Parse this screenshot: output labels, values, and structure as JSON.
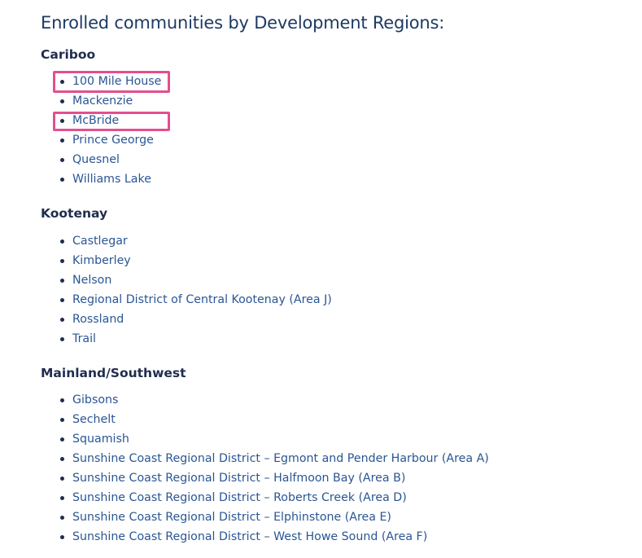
{
  "page": {
    "title": "Enrolled communities by Development Regions:"
  },
  "regions": [
    {
      "name": "Cariboo",
      "communities": [
        "100 Mile House",
        "Mackenzie",
        "McBride",
        "Prince George",
        "Quesnel",
        "Williams Lake"
      ]
    },
    {
      "name": "Kootenay",
      "communities": [
        "Castlegar",
        "Kimberley",
        "Nelson",
        "Regional District of Central Kootenay (Area J)",
        "Rossland",
        "Trail"
      ]
    },
    {
      "name": "Mainland/Southwest",
      "communities": [
        "Gibsons",
        "Sechelt",
        "Squamish",
        "Sunshine Coast Regional District – Egmont and Pender Harbour (Area A)",
        "Sunshine Coast Regional District – Halfmoon Bay (Area B)",
        "Sunshine Coast Regional District – Roberts Creek (Area D)",
        "Sunshine Coast Regional District – Elphinstone (Area E)",
        "Sunshine Coast Regional District – West Howe Sound (Area F)"
      ]
    }
  ],
  "highlighted": [
    "100 Mile House",
    "McBride"
  ],
  "colors": {
    "title": "#1e3a63",
    "heading": "#1f2d4d",
    "link": "#2a5694",
    "highlight": "#e34f8f"
  }
}
